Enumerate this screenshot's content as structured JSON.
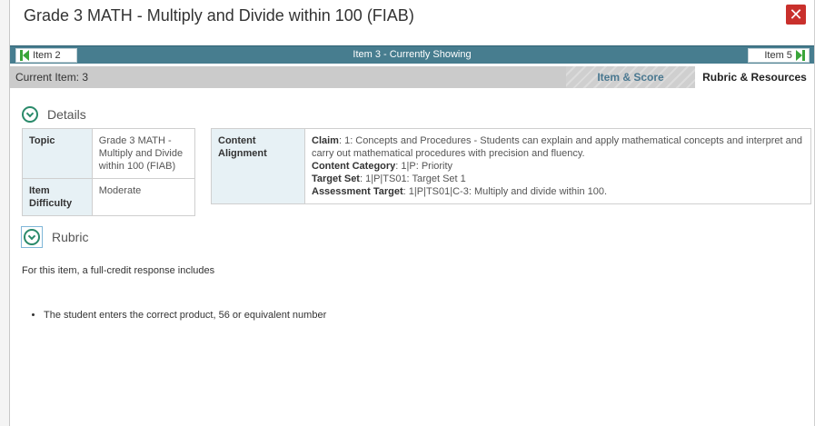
{
  "window": {
    "title": "Grade 3 MATH - Multiply and Divide within 100 (FIAB)",
    "close_icon": "close-x-icon"
  },
  "nav": {
    "prev_label": "Item 2",
    "center_label": "Item 3 - Currently Showing",
    "next_label": "Item 5"
  },
  "tabs": {
    "current_item": "Current Item: 3",
    "score_label": "Item & Score",
    "rubric_label": "Rubric & Resources"
  },
  "details": {
    "heading": "Details",
    "topic_label": "Topic",
    "topic_value": "Grade 3 MATH - Multiply and Divide within 100 (FIAB)",
    "difficulty_label": "Item Difficulty",
    "difficulty_value": "Moderate",
    "alignment_label": "Content Alignment",
    "claim_label": "Claim",
    "claim_value": ": 1: Concepts and Procedures - Students can explain and apply mathematical concepts and interpret and carry out mathematical procedures with precision and fluency.",
    "category_label": "Content Category",
    "category_value": ": 1|P: Priority",
    "target_set_label": "Target Set",
    "target_set_value": ": 1|P|TS01: Target Set 1",
    "assessment_label": "Assessment Target",
    "assessment_value": ": 1|P|TS01|C-3: Multiply and divide within 100."
  },
  "rubric": {
    "heading": "Rubric",
    "intro": "For this item, a full-credit response includes",
    "items": [
      "The student enters the correct product, 56 or equivalent number"
    ]
  },
  "colors": {
    "nav_bar": "#477d8f",
    "close": "#c9302c",
    "arrows": "#3aa53a",
    "toggle": "#2a8a6a"
  }
}
